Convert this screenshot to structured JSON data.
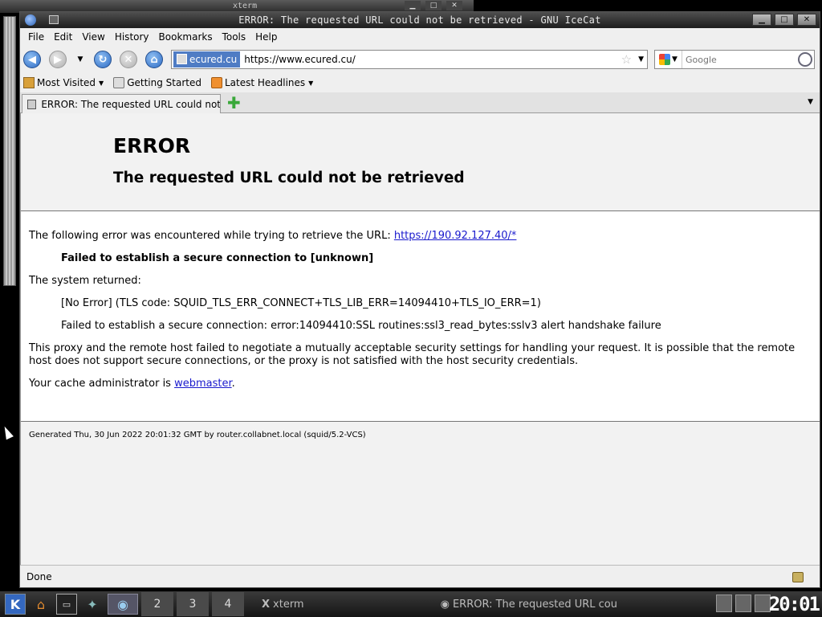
{
  "background": {
    "xterm_title": "xterm",
    "xterm_buttons": [
      "▁",
      "□",
      "✕"
    ]
  },
  "window": {
    "title": "ERROR: The requested URL could not be retrieved - GNU IceCat",
    "buttons": {
      "minimize": "▁",
      "maximize": "□",
      "close": "✕"
    }
  },
  "menu": [
    "File",
    "Edit",
    "View",
    "History",
    "Bookmarks",
    "Tools",
    "Help"
  ],
  "nav": {
    "back": "◀",
    "forward": "▶",
    "reload": "↻",
    "stop": "✕",
    "home": "⌂",
    "history_dropdown": "▼",
    "site_identity": "ecured.cu",
    "url": "https://www.ecured.cu/",
    "star": "☆",
    "url_dropdown": "▼",
    "search_dropdown": "▼",
    "search_placeholder": "Google"
  },
  "bookmarks": {
    "most_visited": "Most Visited",
    "getting_started": "Getting Started",
    "latest_headlines": "Latest Headlines",
    "arrow": "▼"
  },
  "tabs": {
    "active_label": "ERROR: The requested URL could not ...",
    "new_tab": "✚",
    "list": "▼"
  },
  "page": {
    "title": "ERROR",
    "subtitle": "The requested URL could not be retrieved",
    "intro": "The following error was encountered while trying to retrieve the URL: ",
    "url_link": "https://190.92.127.40/*",
    "failure": "Failed to establish a secure connection to [unknown]",
    "system_returned": "The system returned:",
    "tls_code": "[No Error] (TLS code: SQUID_TLS_ERR_CONNECT+TLS_LIB_ERR=14094410+TLS_IO_ERR=1)",
    "ssl_error": "Failed to establish a secure connection: error:14094410:SSL routines:ssl3_read_bytes:sslv3 alert handshake failure",
    "explanation": "This proxy and the remote host failed to negotiate a mutually acceptable security settings for handling your request. It is possible that the remote host does not support secure connections, or the proxy is not satisfied with the host security credentials.",
    "admin_prefix": "Your cache administrator is ",
    "admin_link": "webmaster",
    "admin_suffix": ".",
    "generated": "Generated Thu, 30 Jun 2022 20:01:32 GMT by router.collabnet.local (squid/5.2-VCS)"
  },
  "status": {
    "text": "Done"
  },
  "taskbar": {
    "kmenu": "K",
    "desktops": [
      "2",
      "3",
      "4"
    ],
    "tasks": [
      {
        "icon": "X",
        "label": "xterm"
      },
      {
        "icon": "◉",
        "label": "ERROR: The requested URL cou"
      }
    ],
    "clock": "20:01"
  }
}
